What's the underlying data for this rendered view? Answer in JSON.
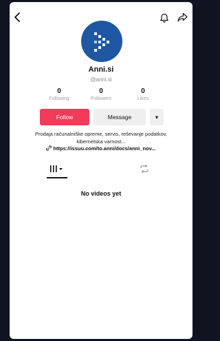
{
  "profile": {
    "name": "Anni.si",
    "handle": "@anni.si"
  },
  "stats": [
    {
      "value": "0",
      "label": "Following"
    },
    {
      "value": "0",
      "label": "Followers"
    },
    {
      "value": "0",
      "label": "Likes"
    }
  ],
  "actions": {
    "follow": "Follow",
    "message": "Message",
    "more": "▾"
  },
  "bio": "Prodaja računalniške opreme, servis, reševanje podatkov, kibernetska varnost...",
  "link": "https://issuu.com/to.anni/docs/anni_nov...",
  "tabs": {
    "videos_icon": "grid-icon",
    "reposts_icon": "repost-icon"
  },
  "empty_state": "No videos yet",
  "colors": {
    "follow_button": "#f03c5a",
    "avatar": "#1f57a3",
    "secondary_button": "#efefef"
  }
}
